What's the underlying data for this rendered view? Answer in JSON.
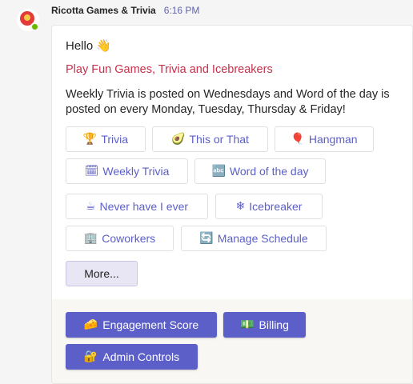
{
  "message": {
    "sender": "Ricotta Games & Trivia",
    "time": "6:16 PM",
    "avatar_icon": "ricotta-logo-icon",
    "status_icon": "available-status-icon",
    "status_color": "#6bb700"
  },
  "card": {
    "greeting": "Hello",
    "greeting_icon": "👋",
    "headline": "Play Fun Games, Trivia and Icebreakers",
    "headline_color": "#c4314b",
    "description": "Weekly Trivia is posted on Wednesdays and Word of the day is posted on every Monday, Tuesday, Thursday & Friday!",
    "actions": [
      {
        "icon": "🏆",
        "icon_name": "trophy-icon",
        "label": "Trivia"
      },
      {
        "icon": "🥑",
        "icon_name": "avocado-icon",
        "label": "This or That"
      },
      {
        "icon": "🎈",
        "icon_name": "balloon-icon",
        "label": "Hangman"
      },
      {
        "icon": "🗓",
        "icon_name": "calendar-icon",
        "label": "Weekly Trivia"
      },
      {
        "icon": "🔤",
        "icon_name": "abcd-icon",
        "label": "Word of the day"
      },
      {
        "icon": "☕",
        "icon_name": "coffee-icon",
        "label": "Never have I ever"
      },
      {
        "icon": "❄",
        "icon_name": "snowflake-icon",
        "label": "Icebreaker"
      },
      {
        "icon": "🏢",
        "icon_name": "office-building-icon",
        "label": "Coworkers"
      },
      {
        "icon": "🔄",
        "icon_name": "refresh-icon",
        "label": "Manage Schedule"
      }
    ],
    "more_label": "More..."
  },
  "footer": {
    "accent": "#5b5fc7",
    "actions": [
      {
        "icon": "🧀",
        "icon_name": "cheese-icon",
        "label": "Engagement Score"
      },
      {
        "icon": "💵",
        "icon_name": "money-icon",
        "label": "Billing"
      },
      {
        "icon": "🔐",
        "icon_name": "lock-key-icon",
        "label": "Admin Controls"
      }
    ]
  }
}
